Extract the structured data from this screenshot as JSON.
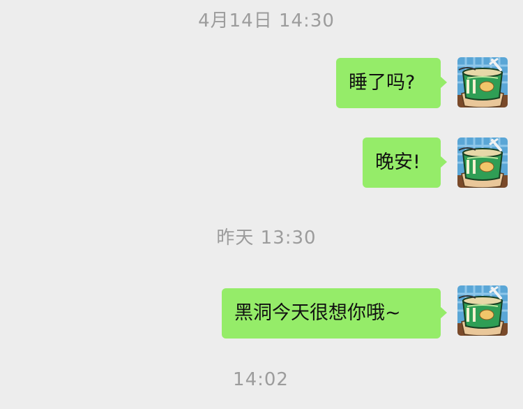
{
  "chat": {
    "timestamps": [
      "4月14日  14:30",
      "昨天  13:30",
      "14:02"
    ],
    "messages": [
      {
        "text": "睡了吗?"
      },
      {
        "text": "晚安!"
      },
      {
        "text": "黑洞今天很想你哦~"
      }
    ]
  },
  "colors": {
    "background": "#ededed",
    "bubble": "#95ec69",
    "timestamp": "#9c9c9c"
  },
  "icons": {
    "avatar": "instant-noodle-cup-icon"
  }
}
